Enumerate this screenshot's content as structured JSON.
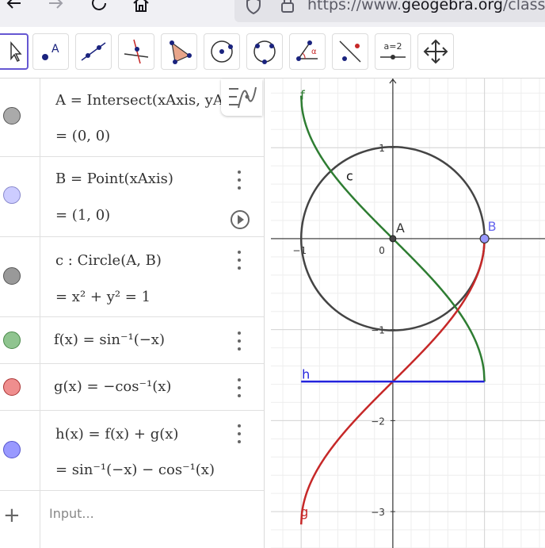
{
  "browser": {
    "url_prefix": "https://www.",
    "url_host": "geogebra.org",
    "url_suffix": "/classic"
  },
  "toolbar": {
    "tools": [
      {
        "name": "move-tool",
        "active": true
      },
      {
        "name": "point-tool",
        "label": "A"
      },
      {
        "name": "line-tool"
      },
      {
        "name": "perpendicular-line-tool"
      },
      {
        "name": "polygon-tool"
      },
      {
        "name": "circle-center-point-tool"
      },
      {
        "name": "circle-three-points-tool"
      },
      {
        "name": "angle-tool",
        "label": "α"
      },
      {
        "name": "reflect-tool"
      },
      {
        "name": "slider-tool",
        "label": "a=2"
      },
      {
        "name": "move-graphics-view-tool"
      }
    ]
  },
  "algebra": {
    "rows": [
      {
        "def": "A = Intersect(xAxis, yAxis)",
        "value": "= (0, 0)",
        "color": "#aaaaaa"
      },
      {
        "def": "B = Point(xAxis)",
        "value": "= (1, 0)",
        "color": "#ccccff"
      },
      {
        "def": "c : Circle(A, B)",
        "value": "= x² + y² = 1",
        "color": "#999999"
      },
      {
        "def": "f(x) = sin⁻¹(−x)",
        "color": "#8fc48f"
      },
      {
        "def": "g(x) = −cos⁻¹(x)",
        "color": "#ef8e8e"
      },
      {
        "def": "h(x) = f(x) + g(x)",
        "value": "= sin⁻¹(−x) − cos⁻¹(x)",
        "color": "#9999ff"
      }
    ],
    "input_placeholder": "Input..."
  },
  "graphics": {
    "xlim": [
      -1.33,
      1.66
    ],
    "ylim": [
      -3.4,
      1.76
    ],
    "x_ticks": [
      -1
    ],
    "y_ticks": [
      1,
      -1,
      -2,
      -3
    ],
    "origin_label": "0",
    "labels": {
      "A": "A",
      "B": "B",
      "c": "c",
      "f": "f",
      "g": "g",
      "h": "h"
    },
    "colors": {
      "f": "#2e7d32",
      "g": "#c62828",
      "h": "#2222dd",
      "c": "#444444",
      "B": "#6666ee",
      "A": "#444444"
    },
    "points": {
      "A": [
        0,
        0
      ],
      "B": [
        1,
        0
      ]
    }
  }
}
